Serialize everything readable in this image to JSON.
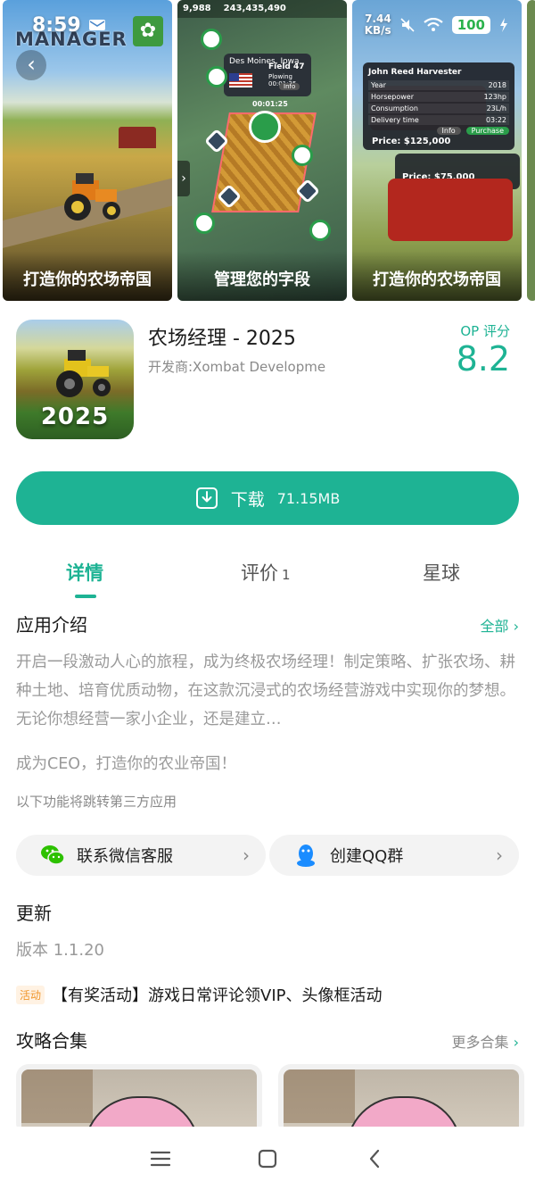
{
  "status_bar": {
    "time": "8:59",
    "net_speed_value": "7.44",
    "net_speed_unit": "KB/s",
    "battery": "100"
  },
  "gallery": {
    "shots": [
      {
        "caption": "打造你的农场帝国",
        "logo": "MANAGER"
      },
      {
        "caption": "管理您的字段",
        "coins": "9,988",
        "money": "243,435,490",
        "card_title": "Field 47",
        "card_city": "Des Moines, Iowa",
        "card_status": "Plowing 00:01:25",
        "card_info": "Info",
        "timer": "00:01:25"
      },
      {
        "caption": "打造你的农场帝国",
        "card_title": "John Reed Harvester",
        "rows": [
          [
            "Year",
            "2018"
          ],
          [
            "Horsepower",
            "123hp"
          ],
          [
            "Consumption",
            "23L/h"
          ],
          [
            "Delivery time",
            "03:22"
          ]
        ],
        "price1": "Price: $125,000",
        "price2": "Price: $75,000",
        "info": "Info",
        "purchase": "Purchase"
      }
    ]
  },
  "app": {
    "name": "农场经理 - 2025",
    "developer": "开发商:Xombat Developme",
    "icon_year": "2025",
    "score_label": "OP 评分",
    "score_value": "8.2"
  },
  "download": {
    "label": "下载",
    "size": "71.15MB"
  },
  "tabs": [
    {
      "label": "详情",
      "active": true
    },
    {
      "label": "评价",
      "count": "1"
    },
    {
      "label": "星球"
    }
  ],
  "intro": {
    "title": "应用介绍",
    "more": "全部",
    "text": "开启一段激动人心的旅程，成为终极农场经理！制定策略、扩张农场、耕种土地、培育优质动物，在这款沉浸式的农场经营游戏中实现你的梦想。无论你想经营一家小企业，还是建立…",
    "text2": "成为CEO，打造你的农业帝国！",
    "third_party_note": "以下功能将跳转第三方应用"
  },
  "contact": {
    "wechat": "联系微信客服",
    "qq": "创建QQ群"
  },
  "update": {
    "title": "更新",
    "version": "版本 1.1.20"
  },
  "promo": {
    "badge": "活动",
    "text": "【有奖活动】游戏日常评论领VIP、头像框活动"
  },
  "guides": {
    "title": "攻略合集",
    "more": "更多合集"
  },
  "colors": {
    "accent": "#1eb394",
    "promo_badge": "#f0962c"
  }
}
